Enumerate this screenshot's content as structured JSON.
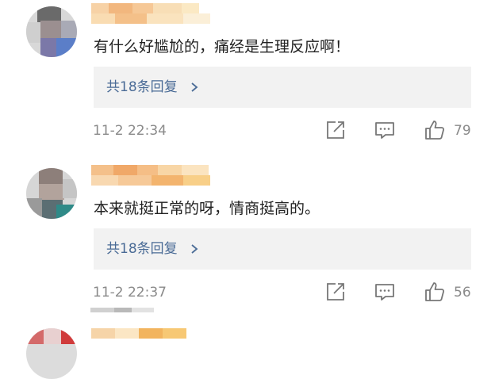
{
  "comments": [
    {
      "text": "有什么好尴尬的，痛经是生理反应啊！",
      "replies_label": "共18条回复",
      "time": "11-2 22:34",
      "likes": "79"
    },
    {
      "text": "本来就挺正常的呀，情商挺高的。",
      "replies_label": "共18条回复",
      "time": "11-2 22:37",
      "likes": "56"
    }
  ],
  "icons": {
    "share": "share-icon",
    "reply": "reply-icon",
    "like": "thumbs-up-icon",
    "chevron": "chevron-right-icon"
  },
  "colors": {
    "reply_link": "#4a6b96",
    "meta_text": "#8a8a8a",
    "reply_box_bg": "#f2f2f2"
  }
}
